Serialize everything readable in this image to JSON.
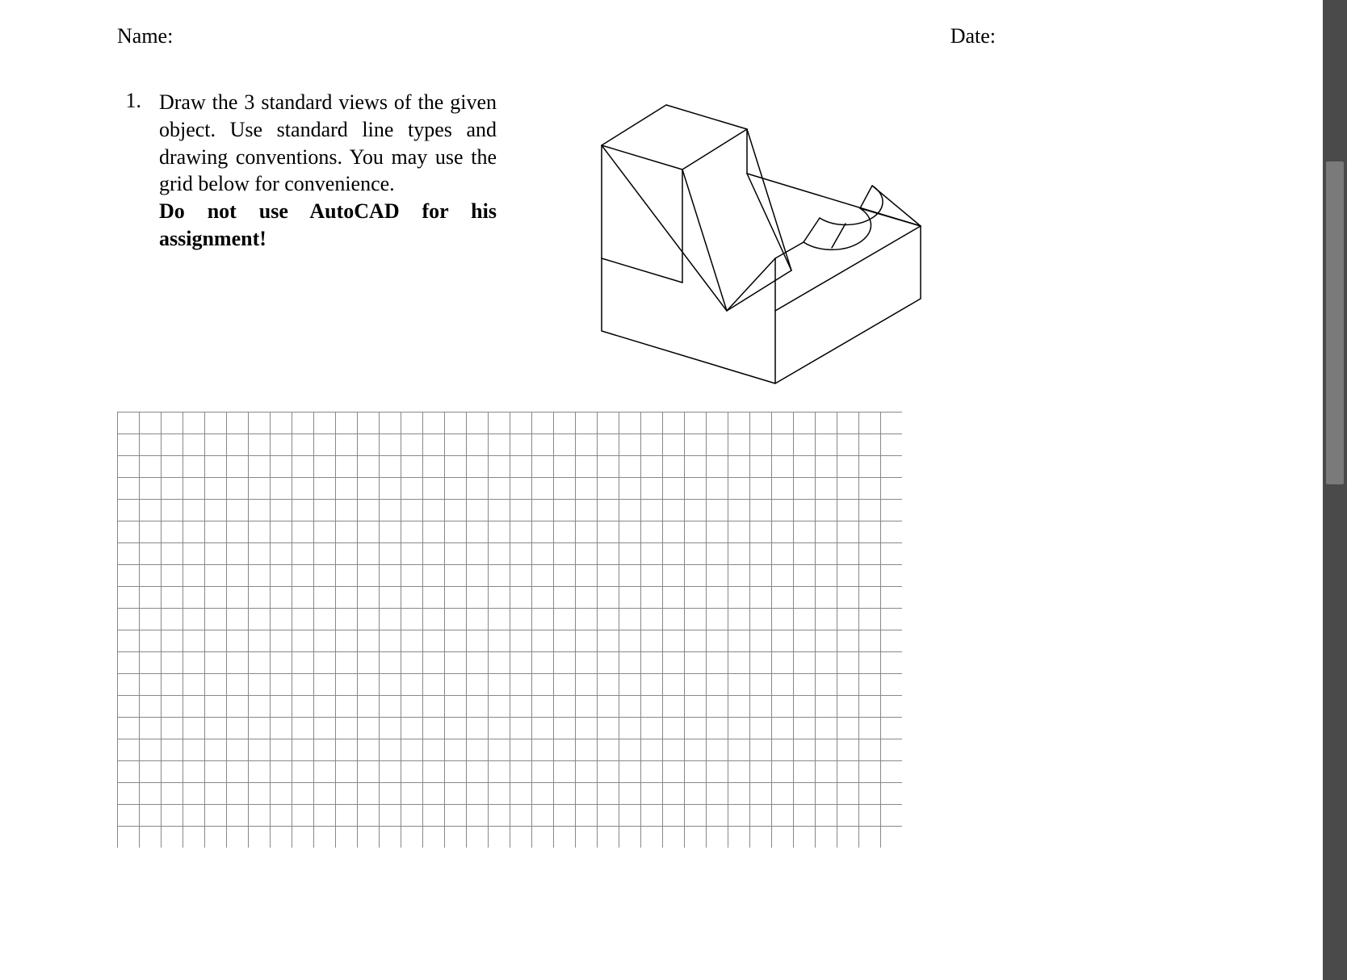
{
  "header": {
    "name_label": "Name:",
    "date_label": "Date:"
  },
  "question": {
    "number": "1.",
    "body": "Draw the 3 standard views of the given object. Use standard line types and drawing conventions. You may use the grid below for convenience.",
    "bold_line": "Do not use AutoCAD for his assignment!"
  },
  "grid": {
    "cols": 36,
    "rows": 20,
    "cell": 27
  }
}
